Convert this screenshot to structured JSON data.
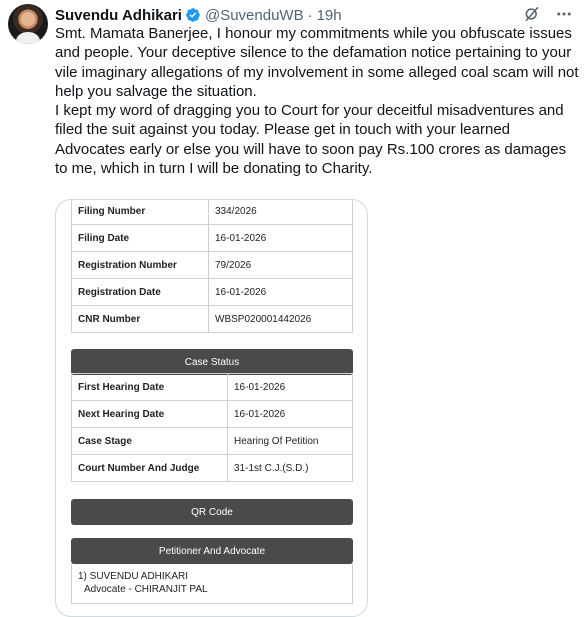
{
  "author": {
    "name": "Suvendu Adhikari",
    "handle": "@SuvenduWB",
    "separator": "·",
    "time": "19h",
    "verified_color": "#1d9bf0"
  },
  "tweet": {
    "line1": "Smt. Mamata Banerjee, I honour my commitments while you obfuscate issues and people. Your deceptive silence to the defamation notice pertaining to your vile imaginary allegations of my involvement in some alleged coal scam will not help you salvage the situation.",
    "line2": "I kept my word of dragging you to Court for your deceitful misadventures and filed the suit against you today. Please get in touch with your learned Advocates early or else you will have to soon pay Rs.100 crores as damages to me, which in turn I will be donating to Charity."
  },
  "document": {
    "case_details": [
      {
        "label": "Filing Number",
        "value": "334/2026"
      },
      {
        "label": "Filing Date",
        "value": "16-01-2026"
      },
      {
        "label": "Registration Number",
        "value": "79/2026"
      },
      {
        "label": "Registration Date",
        "value": "16-01-2026"
      },
      {
        "label": "CNR Number",
        "value": "WBSP020001442026"
      }
    ],
    "case_status_title": "Case Status",
    "case_status": [
      {
        "label": "First Hearing Date",
        "value": "16-01-2026"
      },
      {
        "label": "Next Hearing Date",
        "value": "16-01-2026"
      },
      {
        "label": "Case Stage",
        "value": "Hearing Of Petition"
      },
      {
        "label": "Court Number And Judge",
        "value": "31-1st C.J.(S.D.)"
      }
    ],
    "qr_label": "QR Code",
    "petitioner_title": "Petitioner And Advocate",
    "petitioner": "1) SUVENDU ADHIKARI",
    "advocate": "Advocate - CHIRANJIT PAL"
  },
  "icons": {
    "grok": "grok-icon",
    "more": "more-icon"
  }
}
